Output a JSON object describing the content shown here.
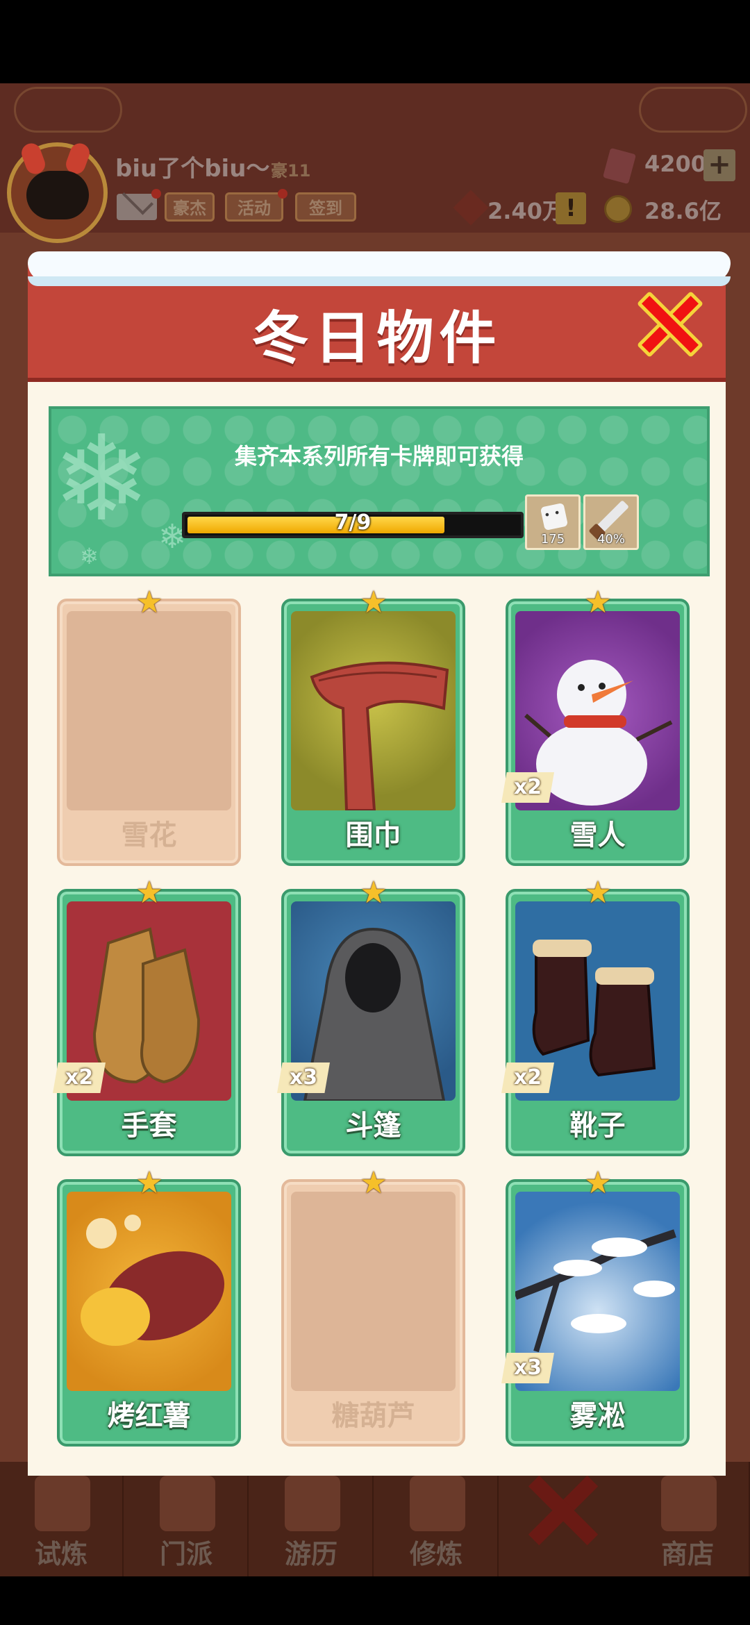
{
  "background": {
    "player": {
      "name": "biu了个biu～",
      "title": "豪11"
    },
    "buttons": [
      "豪杰",
      "活动",
      "签到"
    ],
    "resources": {
      "gems": "4200",
      "gems_plus": "+",
      "coins": "2.40万",
      "alert": "!",
      "gold": "28.6亿"
    },
    "nav": [
      "试炼",
      "门派",
      "游历",
      "修炼",
      "",
      "商店"
    ]
  },
  "modal": {
    "title": "冬日物件",
    "close_icon": "close-icon",
    "banner": {
      "text": "集齐本系列所有卡牌即可获得",
      "progress": {
        "current": 7,
        "total": 9,
        "label": "7/9"
      },
      "rewards": [
        {
          "icon": "dice-icon",
          "value": "175"
        },
        {
          "icon": "sword-icon",
          "value": "40%"
        }
      ]
    },
    "cards": [
      {
        "name": "雪花",
        "owned": false,
        "count": ""
      },
      {
        "name": "围巾",
        "owned": true,
        "count": ""
      },
      {
        "name": "雪人",
        "owned": true,
        "count": "x2"
      },
      {
        "name": "手套",
        "owned": true,
        "count": "x2"
      },
      {
        "name": "斗篷",
        "owned": true,
        "count": "x3"
      },
      {
        "name": "靴子",
        "owned": true,
        "count": "x2"
      },
      {
        "name": "烤红薯",
        "owned": true,
        "count": ""
      },
      {
        "name": "糖葫芦",
        "owned": false,
        "count": ""
      },
      {
        "name": "雾凇",
        "owned": true,
        "count": "x3"
      }
    ]
  },
  "colors": {
    "accent_red": "#c3463a",
    "card_green": "#4ebb84",
    "star_gold": "#f6c02a",
    "progress_yellow": "#f0a800"
  }
}
